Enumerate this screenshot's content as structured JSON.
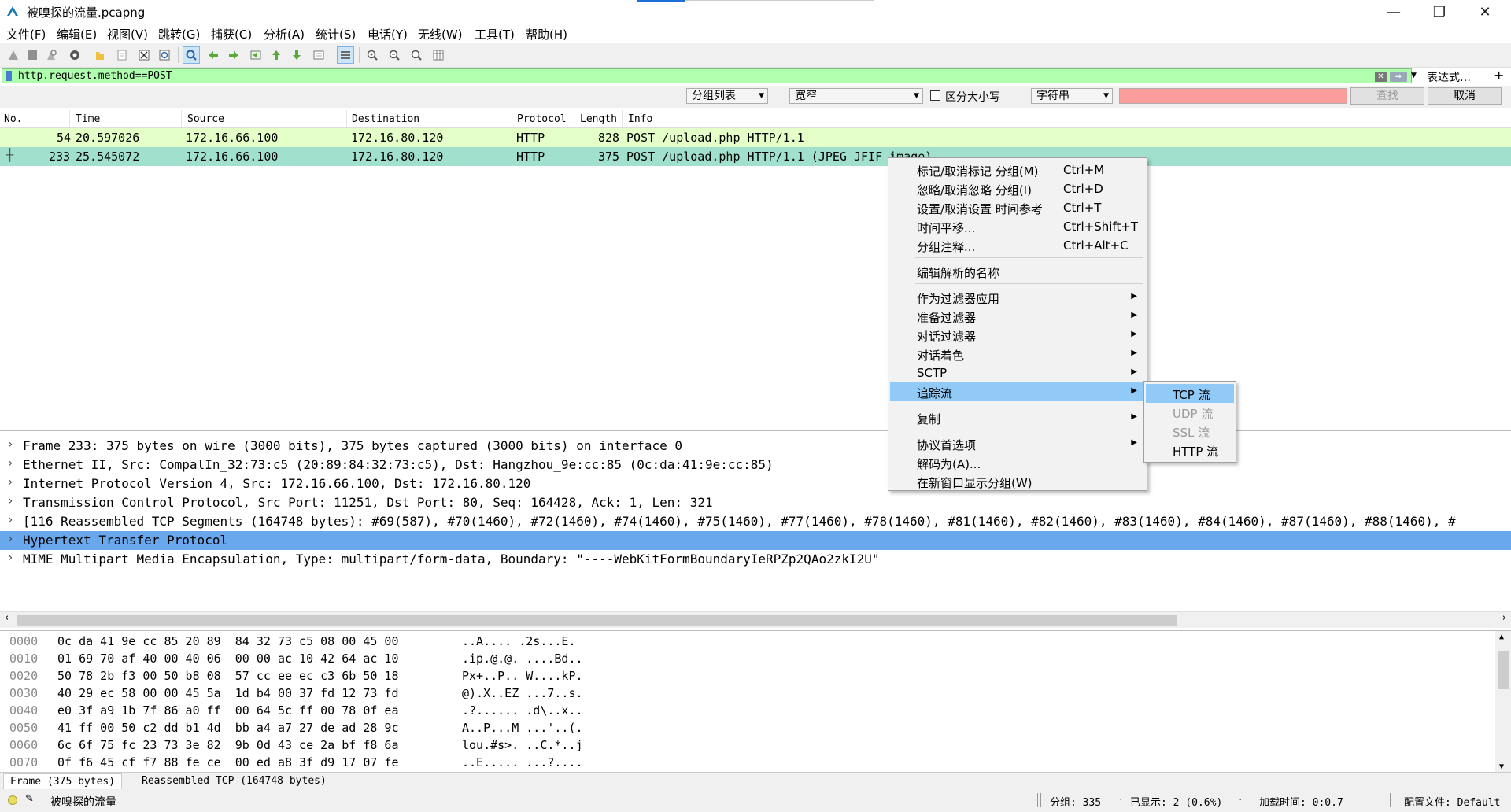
{
  "window": {
    "title": "被嗅探的流量.pcapng",
    "controls": [
      "—",
      "❐",
      "✕"
    ]
  },
  "menu": [
    "文件(F)",
    "编辑(E)",
    "视图(V)",
    "跳转(G)",
    "捕获(C)",
    "分析(A)",
    "统计(S)",
    "电话(Y)",
    "无线(W)",
    "工具(T)",
    "帮助(H)"
  ],
  "filter": {
    "value": "http.request.method==POST",
    "expression_label": "表达式…",
    "plus": "+"
  },
  "search": {
    "scope": "分组列表",
    "charset": "宽窄",
    "case_label": "区分大小写",
    "type": "字符串",
    "find_label": "查找",
    "cancel_label": "取消"
  },
  "packet_list": {
    "columns": [
      "No.",
      "Time",
      "Source",
      "Destination",
      "Protocol",
      "Length",
      "Info"
    ],
    "rows": [
      {
        "no": "54",
        "time": "20.597026",
        "src": "172.16.66.100",
        "dst": "172.16.80.120",
        "proto": "HTTP",
        "len": "828",
        "info": "POST /upload.php HTTP/1.1"
      },
      {
        "no": "233",
        "time": "25.545072",
        "src": "172.16.66.100",
        "dst": "172.16.80.120",
        "proto": "HTTP",
        "len": "375",
        "info": "POST /upload.php HTTP/1.1  (JPEG JFIF image)"
      }
    ]
  },
  "details": [
    "Frame 233: 375 bytes on wire (3000 bits), 375 bytes captured (3000 bits) on interface 0",
    "Ethernet II, Src: CompalIn_32:73:c5 (20:89:84:32:73:c5), Dst: Hangzhou_9e:cc:85 (0c:da:41:9e:cc:85)",
    "Internet Protocol Version 4, Src: 172.16.66.100, Dst: 172.16.80.120",
    "Transmission Control Protocol, Src Port: 11251, Dst Port: 80, Seq: 164428, Ack: 1, Len: 321",
    "[116 Reassembled TCP Segments (164748 bytes): #69(587), #70(1460), #72(1460), #74(1460), #75(1460), #77(1460), #78(1460), #81(1460), #82(1460), #83(1460), #84(1460), #87(1460), #88(1460), #",
    "Hypertext Transfer Protocol",
    "MIME Multipart Media Encapsulation, Type: multipart/form-data, Boundary: \"----WebKitFormBoundaryIeRPZp2QAo2zkI2U\""
  ],
  "bytes": [
    {
      "off": "0000",
      "hex": "0c da 41 9e cc 85 20 89  84 32 73 c5 08 00 45 00",
      "ascii": "..A.... .2s...E."
    },
    {
      "off": "0010",
      "hex": "01 69 70 af 40 00 40 06  00 00 ac 10 42 64 ac 10",
      "ascii": ".ip.@.@. ....Bd.."
    },
    {
      "off": "0020",
      "hex": "50 78 2b f3 00 50 b8 08  57 cc ee ec c3 6b 50 18",
      "ascii": "Px+..P.. W....kP."
    },
    {
      "off": "0030",
      "hex": "40 29 ec 58 00 00 45 5a  1d b4 00 37 fd 12 73 fd",
      "ascii": "@).X..EZ ...7..s."
    },
    {
      "off": "0040",
      "hex": "e0 3f a9 1b 7f 86 a0 ff  00 64 5c ff 00 78 0f ea",
      "ascii": ".?...... .d\\..x.."
    },
    {
      "off": "0050",
      "hex": "41 ff 00 50 c2 dd b1 4d  bb a4 a7 27 de ad 28 9c",
      "ascii": "A..P...M ...'..(."
    },
    {
      "off": "0060",
      "hex": "6c 6f 75 fc 23 73 3e 82  9b 0d 43 ce 2a bf f8 6a",
      "ascii": "lou.#s>. ..C.*..j"
    },
    {
      "off": "0070",
      "hex": "0f f6 45 cf f7 88 fe ce  00 ed a8 3f d9 17 07 fe",
      "ascii": "..E..... ...?...."
    }
  ],
  "byte_tabs": [
    "Frame (375 bytes)",
    "Reassembled TCP (164748 bytes)"
  ],
  "status": {
    "file": "被嗅探的流量",
    "packets": "分组: 335",
    "displayed": "已显示: 2 (0.6%)",
    "load_time": "加载时间: 0:0.7",
    "profile": "配置文件: Default"
  },
  "context_menu": {
    "items": [
      {
        "label": "标记/取消标记 分组(M)",
        "shortcut": "Ctrl+M"
      },
      {
        "label": "忽略/取消忽略 分组(I)",
        "shortcut": "Ctrl+D"
      },
      {
        "label": "设置/取消设置 时间参考",
        "shortcut": "Ctrl+T"
      },
      {
        "label": "时间平移...",
        "shortcut": "Ctrl+Shift+T"
      },
      {
        "label": "分组注释...",
        "shortcut": "Ctrl+Alt+C"
      },
      {
        "label": "编辑解析的名称",
        "shortcut": ""
      },
      {
        "label": "作为过滤器应用",
        "shortcut": ""
      },
      {
        "label": "准备过滤器",
        "shortcut": ""
      },
      {
        "label": "对话过滤器",
        "shortcut": ""
      },
      {
        "label": "对话着色",
        "shortcut": ""
      },
      {
        "label": "SCTP",
        "shortcut": ""
      },
      {
        "label": "追踪流",
        "shortcut": ""
      },
      {
        "label": "复制",
        "shortcut": ""
      },
      {
        "label": "协议首选项",
        "shortcut": ""
      },
      {
        "label": "解码为(A)...",
        "shortcut": ""
      },
      {
        "label": "在新窗口显示分组(W)",
        "shortcut": ""
      }
    ],
    "submenu": [
      "TCP 流",
      "UDP 流",
      "SSL 流",
      "HTTP 流"
    ]
  },
  "colors": {
    "filter_ok": "#afffaf",
    "row_http": "#e4ffc7",
    "row_selected": "#a0e0cc",
    "detail_selected": "#69a8ec",
    "menu_highlight": "#91c9f7",
    "search_error": "#ff9c9c"
  }
}
